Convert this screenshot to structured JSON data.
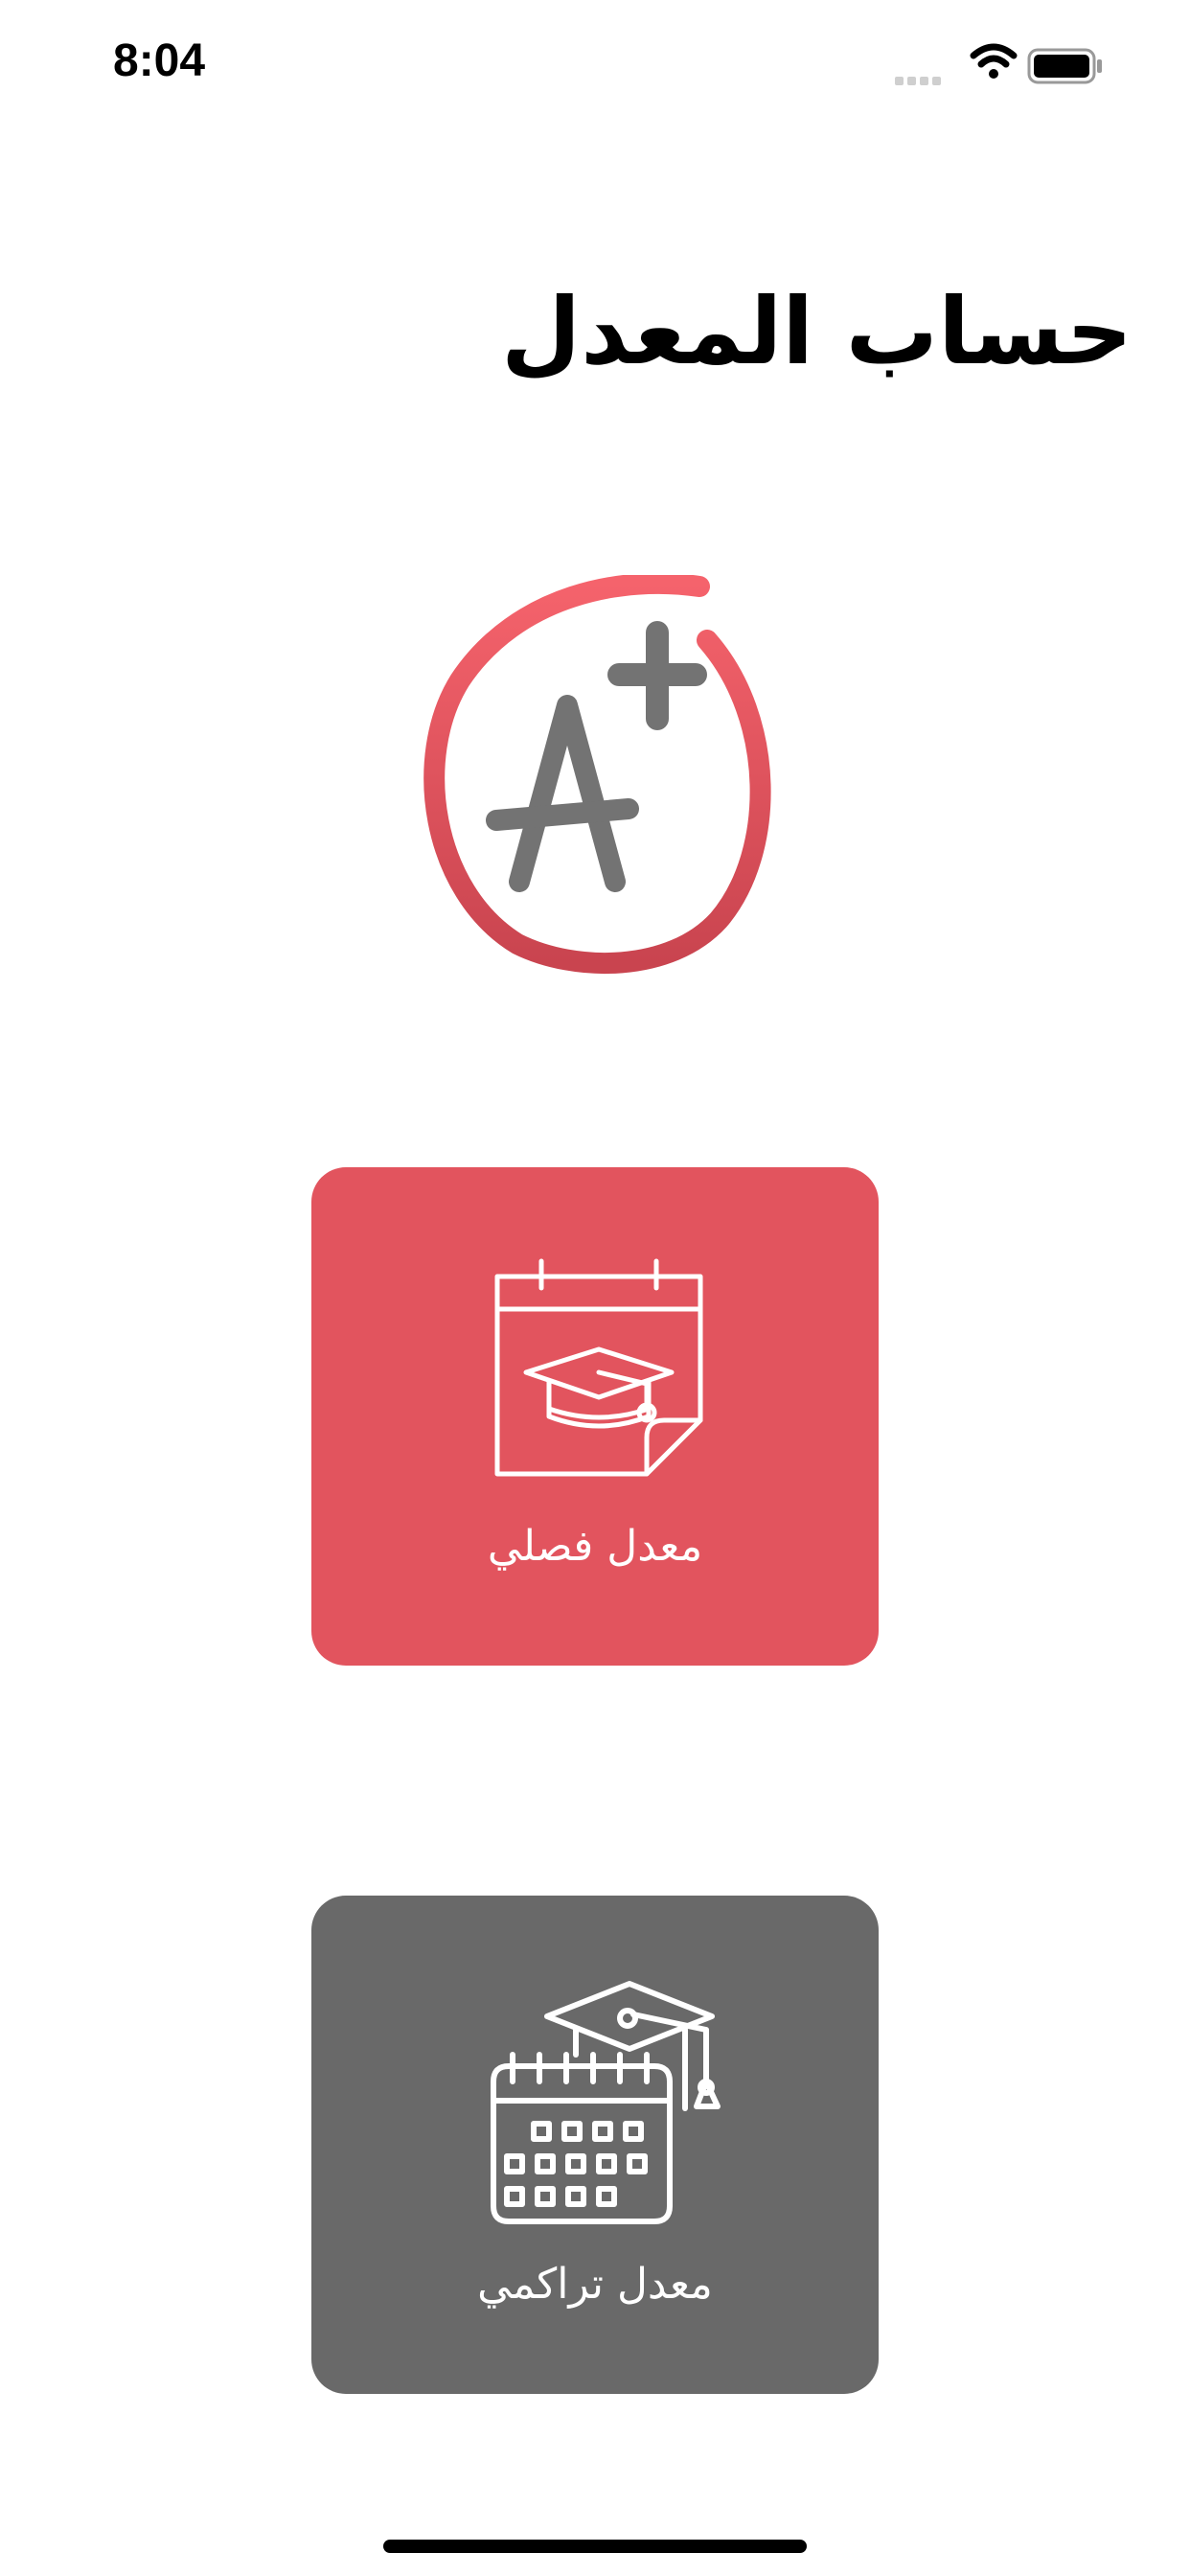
{
  "status_bar": {
    "time": "8:04",
    "icons": [
      "cellular-signal-icon",
      "wifi-icon",
      "battery-icon"
    ]
  },
  "header": {
    "title": "حساب المعدل"
  },
  "logo": {
    "icon": "a-plus-grade-icon",
    "colors": {
      "ring": "#e2545e",
      "letter": "#737373"
    }
  },
  "menu": {
    "semester": {
      "label": "معدل فصلي",
      "icon": "calendar-graduation-cap-icon",
      "color": "#e2545e"
    },
    "cumulative": {
      "label": "معدل تراكمي",
      "icon": "calendar-grid-graduation-cap-icon",
      "color": "#696969"
    }
  }
}
